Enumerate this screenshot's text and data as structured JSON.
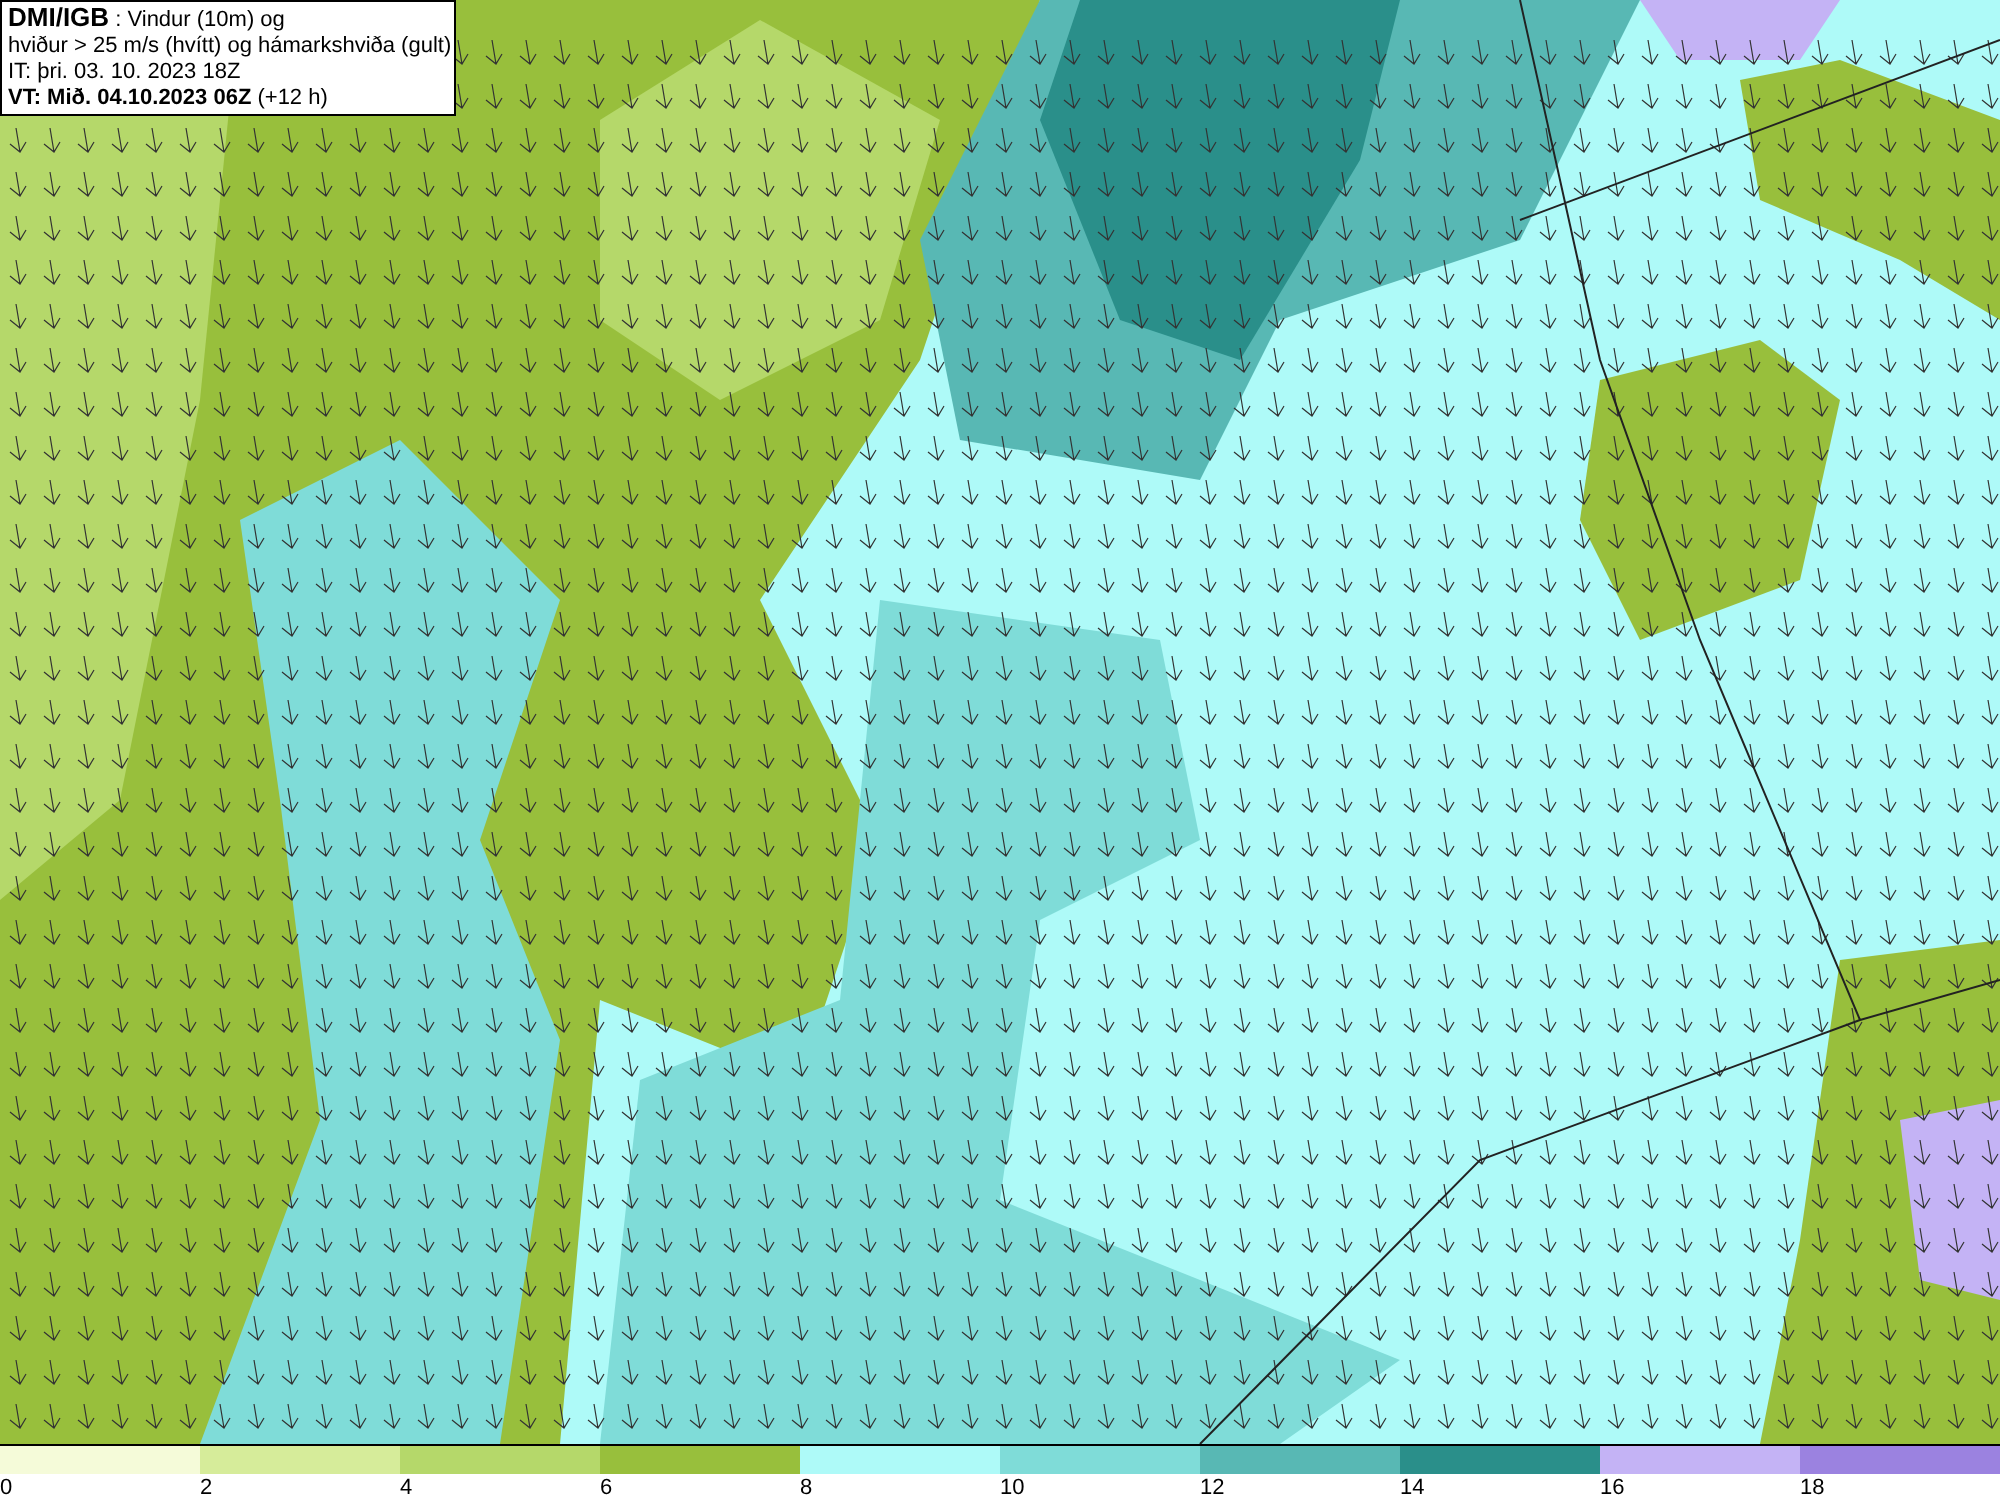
{
  "header": {
    "lines": [
      "**DMI/IGB** : Vindur (10m) og",
      "hviður > 25 m/s (hvítt) og hámarkshviða (gult)",
      "IT: þri. 03. 10. 2023 18Z",
      "**VT: Mið. 04.10.2023 06Z** (+12 h)"
    ]
  },
  "legend": {
    "bins": [
      {
        "color": "#f5fbd9"
      },
      {
        "color": "#d6ec9a"
      },
      {
        "color": "#b5d86a"
      },
      {
        "color": "#98bf3c"
      },
      {
        "color": "#aefaf8"
      },
      {
        "color": "#7fdcd8"
      },
      {
        "color": "#58b8b4"
      },
      {
        "color": "#2a8f8a"
      },
      {
        "color": "#c4b3f5"
      },
      {
        "color": "#9b82e0"
      }
    ],
    "ticks": [
      "0",
      "2",
      "4",
      "6",
      "8",
      "10",
      "12",
      "14",
      "16",
      "18"
    ]
  }
}
